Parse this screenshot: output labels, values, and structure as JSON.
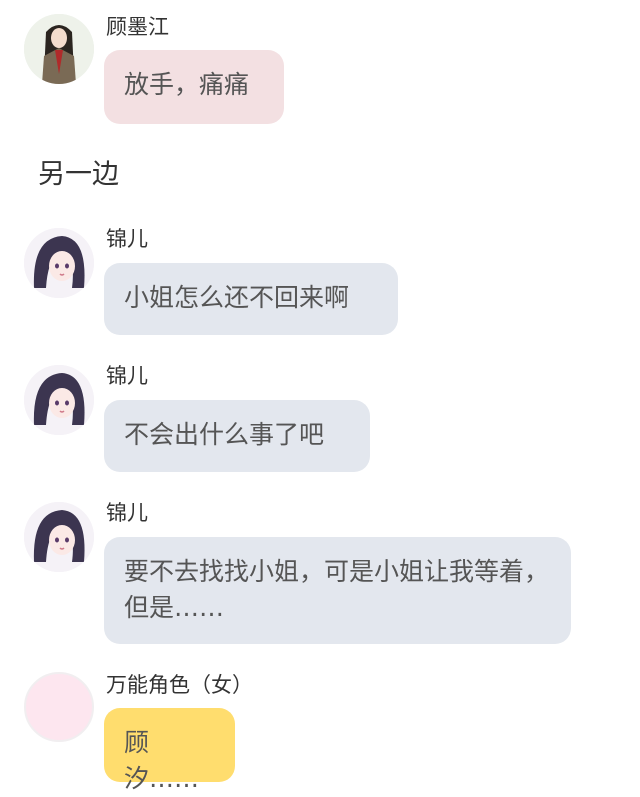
{
  "messages": [
    {
      "sender": "顾墨江",
      "text": "放手，痛痛",
      "avatar": "male-character-avatar"
    },
    {
      "sender": "锦儿",
      "text": "小姐怎么还不回来啊",
      "avatar": "female-character-avatar"
    },
    {
      "sender": "锦儿",
      "text": "不会出什么事了吧",
      "avatar": "female-character-avatar"
    },
    {
      "sender": "锦儿",
      "text": "要不去找找小姐，可是小姐让我等着，但是……",
      "avatar": "female-character-avatar"
    },
    {
      "sender": "万能角色（女）",
      "text": "顾汐……",
      "avatar": "placeholder-avatar"
    }
  ],
  "narration": "另一边",
  "colors": {
    "pink_bubble": "#f3e0e2",
    "gray_bubble": "#e3e7ee",
    "yellow_bubble": "#ffdd6e",
    "placeholder_avatar": "#fde6ef"
  }
}
